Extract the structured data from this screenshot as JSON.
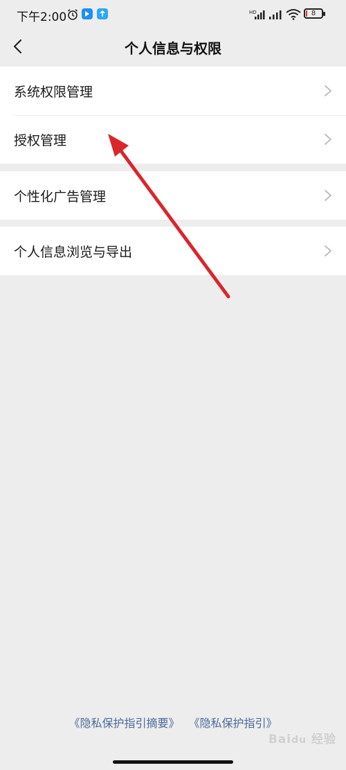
{
  "status_bar": {
    "time": "下午2:00",
    "battery_level": "8",
    "battery_fraction": 0.08,
    "battery_color": "#e0342c",
    "icons": [
      "alarm-icon",
      "app-badge-icon",
      "app-upload-icon",
      "hd-signal-icon",
      "signal-icon",
      "wifi-icon",
      "battery-icon"
    ]
  },
  "header": {
    "title": "个人信息与权限",
    "back_icon": "chevron-left-icon"
  },
  "groups": [
    {
      "items": [
        {
          "label": "系统权限管理"
        },
        {
          "label": "授权管理"
        }
      ]
    },
    {
      "items": [
        {
          "label": "个性化广告管理"
        }
      ]
    },
    {
      "items": [
        {
          "label": "个人信息浏览与导出"
        }
      ]
    }
  ],
  "footer": {
    "link_1": "《隐私保护指引摘要》",
    "link_2": "《隐私保护指引》"
  },
  "annotation": {
    "color": "#d9262c"
  },
  "watermark": "Baidu 经验",
  "colors": {
    "background": "#ededed",
    "card": "#ffffff",
    "link": "#4a6a9a"
  }
}
